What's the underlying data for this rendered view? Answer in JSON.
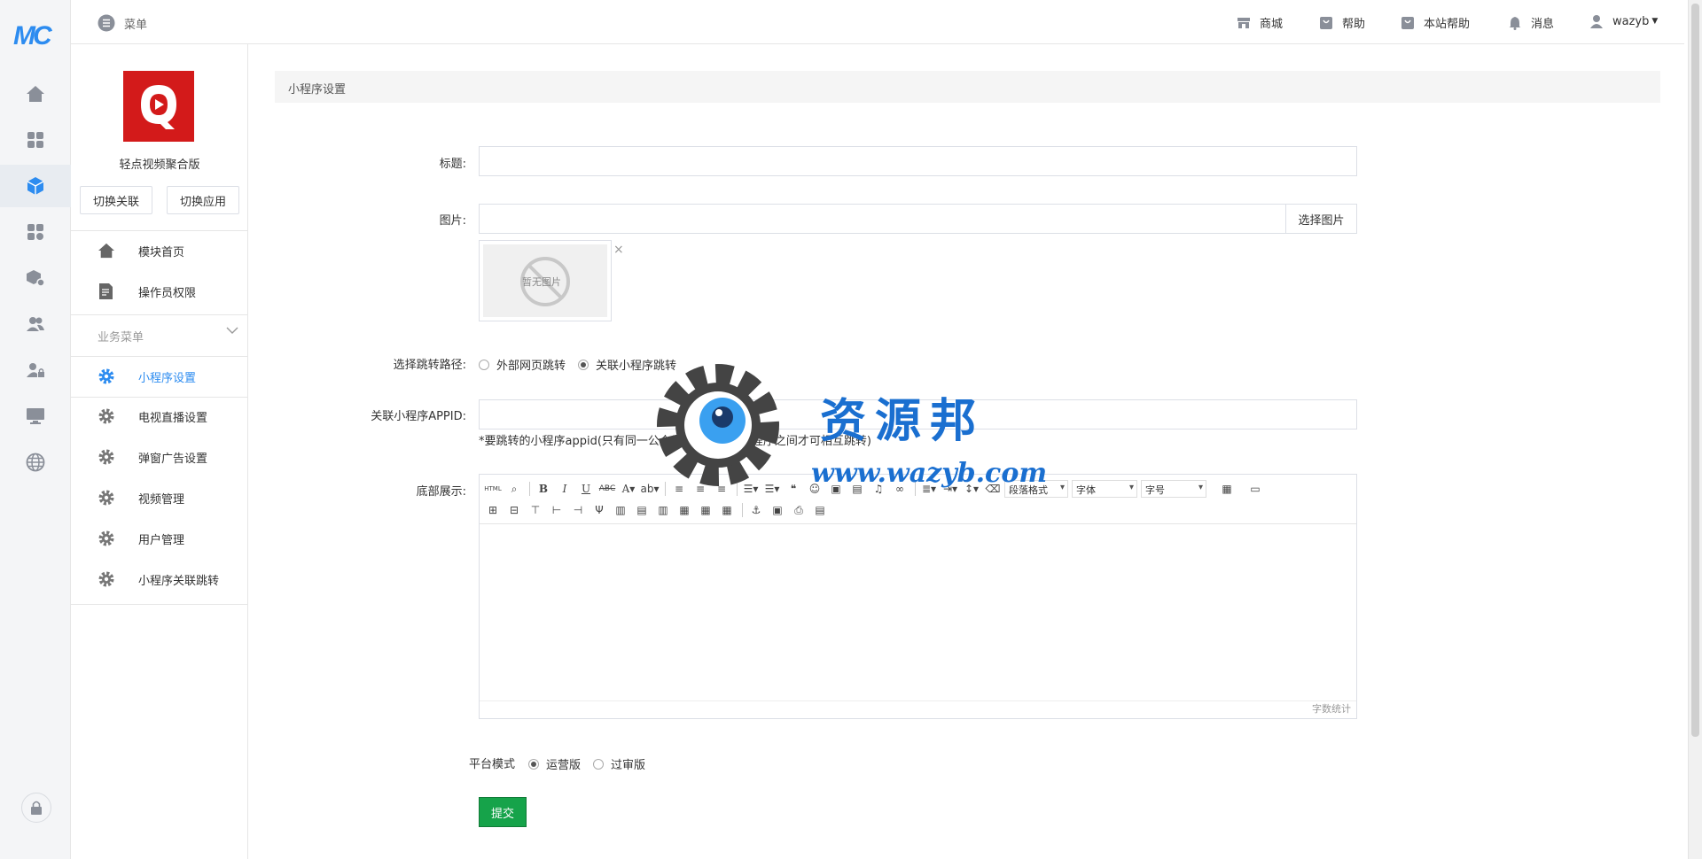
{
  "rail": {
    "logo_text": "MC",
    "icons": [
      "home-icon",
      "apps-grid-icon",
      "cube-icon",
      "modules-icon",
      "box-settings-icon",
      "users-icon",
      "user-lock-icon",
      "monitor-icon",
      "globe-icon",
      "lock-icon"
    ]
  },
  "topbar": {
    "menu_label": "菜单",
    "links": [
      "商城",
      "帮助",
      "本站帮助",
      "消息"
    ],
    "user": "wazyb"
  },
  "app": {
    "name": "轻点视频聚合版",
    "switch_link": "切换关联",
    "switch_app": "切换应用"
  },
  "sidebar": {
    "top_items": [
      "模块首页",
      "操作员权限"
    ],
    "group_title": "业务菜单",
    "items": [
      "小程序设置",
      "电视直播设置",
      "弹窗广告设置",
      "视频管理",
      "用户管理",
      "小程序关联跳转"
    ],
    "active_index": 0,
    "accent": "#2d8cf0"
  },
  "main": {
    "panel_title": "小程序设置",
    "fields": {
      "title_label": "标题:",
      "title_value": "",
      "image_label": "图片:",
      "image_value": "",
      "image_button": "选择图片",
      "image_placeholder": "暂无图片",
      "jump_label": "选择跳转路径:",
      "jump_options": [
        "外部网页跳转",
        "关联小程序跳转"
      ],
      "jump_selected": 1,
      "appid_label": "关联小程序APPID:",
      "appid_value": "",
      "appid_hint": "*要跳转的小程序appid(只有同一公众号下的关联的小程序之间才可相互跳转)",
      "footer_label": "底部展示:",
      "editor_selects": [
        "段落格式",
        "字体",
        "字号"
      ],
      "word_count": "字数统计",
      "platform_label": "平台模式",
      "platform_options": [
        "运营版",
        "过审版"
      ],
      "platform_selected": 0
    },
    "submit_label": "提交"
  },
  "watermark": {
    "title": "资源邦",
    "url": "www.wazyb.com"
  }
}
